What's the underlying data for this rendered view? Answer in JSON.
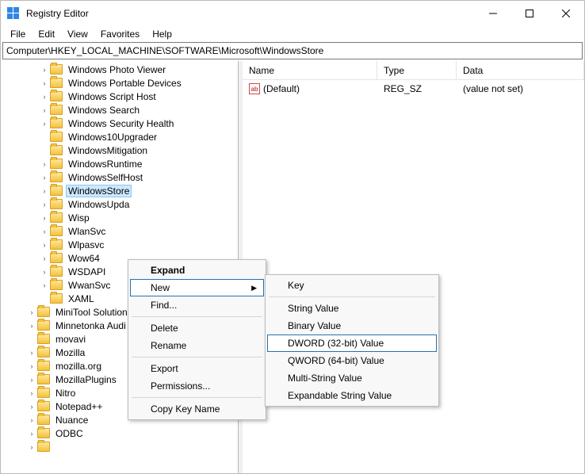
{
  "titlebar": {
    "app_name": "Registry Editor"
  },
  "menu": {
    "file": "File",
    "edit": "Edit",
    "view": "View",
    "favorites": "Favorites",
    "help": "Help"
  },
  "address": {
    "path": "Computer\\HKEY_LOCAL_MACHINE\\SOFTWARE\\Microsoft\\WindowsStore"
  },
  "list": {
    "headers": {
      "name": "Name",
      "type": "Type",
      "data": "Data"
    },
    "rows": [
      {
        "icon": "ab",
        "name": "(Default)",
        "type": "REG_SZ",
        "data": "(value not set)"
      }
    ]
  },
  "tree": {
    "items": [
      {
        "indent": 3,
        "chev": true,
        "label": "Windows Photo Viewer"
      },
      {
        "indent": 3,
        "chev": true,
        "label": "Windows Portable Devices"
      },
      {
        "indent": 3,
        "chev": true,
        "label": "Windows Script Host"
      },
      {
        "indent": 3,
        "chev": true,
        "label": "Windows Search"
      },
      {
        "indent": 3,
        "chev": true,
        "label": "Windows Security Health"
      },
      {
        "indent": 3,
        "chev": false,
        "label": "Windows10Upgrader"
      },
      {
        "indent": 3,
        "chev": false,
        "label": "WindowsMitigation"
      },
      {
        "indent": 3,
        "chev": true,
        "label": "WindowsRuntime"
      },
      {
        "indent": 3,
        "chev": true,
        "label": "WindowsSelfHost"
      },
      {
        "indent": 3,
        "chev": true,
        "label": "WindowsStore",
        "selected": true
      },
      {
        "indent": 3,
        "chev": true,
        "label": "WindowsUpda"
      },
      {
        "indent": 3,
        "chev": true,
        "label": "Wisp"
      },
      {
        "indent": 3,
        "chev": true,
        "label": "WlanSvc"
      },
      {
        "indent": 3,
        "chev": true,
        "label": "Wlpasvc"
      },
      {
        "indent": 3,
        "chev": true,
        "label": "Wow64"
      },
      {
        "indent": 3,
        "chev": true,
        "label": "WSDAPI"
      },
      {
        "indent": 3,
        "chev": true,
        "label": "WwanSvc"
      },
      {
        "indent": 3,
        "chev": false,
        "label": "XAML"
      },
      {
        "indent": 2,
        "chev": true,
        "label": "MiniTool Solution"
      },
      {
        "indent": 2,
        "chev": true,
        "label": "Minnetonka Audi"
      },
      {
        "indent": 2,
        "chev": false,
        "label": "movavi"
      },
      {
        "indent": 2,
        "chev": true,
        "label": "Mozilla"
      },
      {
        "indent": 2,
        "chev": true,
        "label": "mozilla.org"
      },
      {
        "indent": 2,
        "chev": true,
        "label": "MozillaPlugins"
      },
      {
        "indent": 2,
        "chev": true,
        "label": "Nitro"
      },
      {
        "indent": 2,
        "chev": true,
        "label": "Notepad++"
      },
      {
        "indent": 2,
        "chev": true,
        "label": "Nuance"
      },
      {
        "indent": 2,
        "chev": true,
        "label": "ODBC"
      },
      {
        "indent": 2,
        "chev": true,
        "label": ""
      }
    ]
  },
  "cmenu1": {
    "expand": "Expand",
    "new": "New",
    "find": "Find...",
    "delete": "Delete",
    "rename": "Rename",
    "export": "Export",
    "permissions": "Permissions...",
    "copy_key": "Copy Key Name"
  },
  "cmenu2": {
    "key": "Key",
    "string": "String Value",
    "binary": "Binary Value",
    "dword": "DWORD (32-bit) Value",
    "qword": "QWORD (64-bit) Value",
    "multi": "Multi-String Value",
    "expandable": "Expandable String Value"
  }
}
